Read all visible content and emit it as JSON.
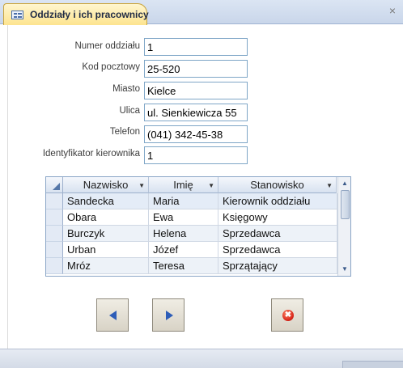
{
  "tab": {
    "title": "Oddziały i ich pracownicy",
    "icon": "form-icon"
  },
  "fields": [
    {
      "label": "Numer oddziału",
      "value": "1"
    },
    {
      "label": "Kod pocztowy",
      "value": "25-520"
    },
    {
      "label": "Miasto",
      "value": "Kielce"
    },
    {
      "label": "Ulica",
      "value": "ul. Sienkiewicza 55"
    },
    {
      "label": "Telefon",
      "value": "(041) 342-45-38"
    },
    {
      "label": "Identyfikator kierownika",
      "value": "1"
    }
  ],
  "grid": {
    "columns": [
      "Nazwisko",
      "Imię",
      "Stanowisko"
    ],
    "rows": [
      [
        "Sandecka",
        "Maria",
        "Kierownik oddziału"
      ],
      [
        "Obara",
        "Ewa",
        "Księgowy"
      ],
      [
        "Burczyk",
        "Helena",
        "Sprzedawca"
      ],
      [
        "Urban",
        "Józef",
        "Sprzedawca"
      ],
      [
        "Mróz",
        "Teresa",
        "Sprzątający"
      ]
    ]
  },
  "buttons": {
    "prev_icon": "triangle-left-icon",
    "next_icon": "triangle-right-icon",
    "close_icon": "stop-circle-icon",
    "close_glyph": "✖"
  },
  "colors": {
    "tab_bg": "#fde48f",
    "field_border": "#7fa6c7",
    "nav_arrow": "#2d5db8",
    "close_red": "#d8261a"
  }
}
